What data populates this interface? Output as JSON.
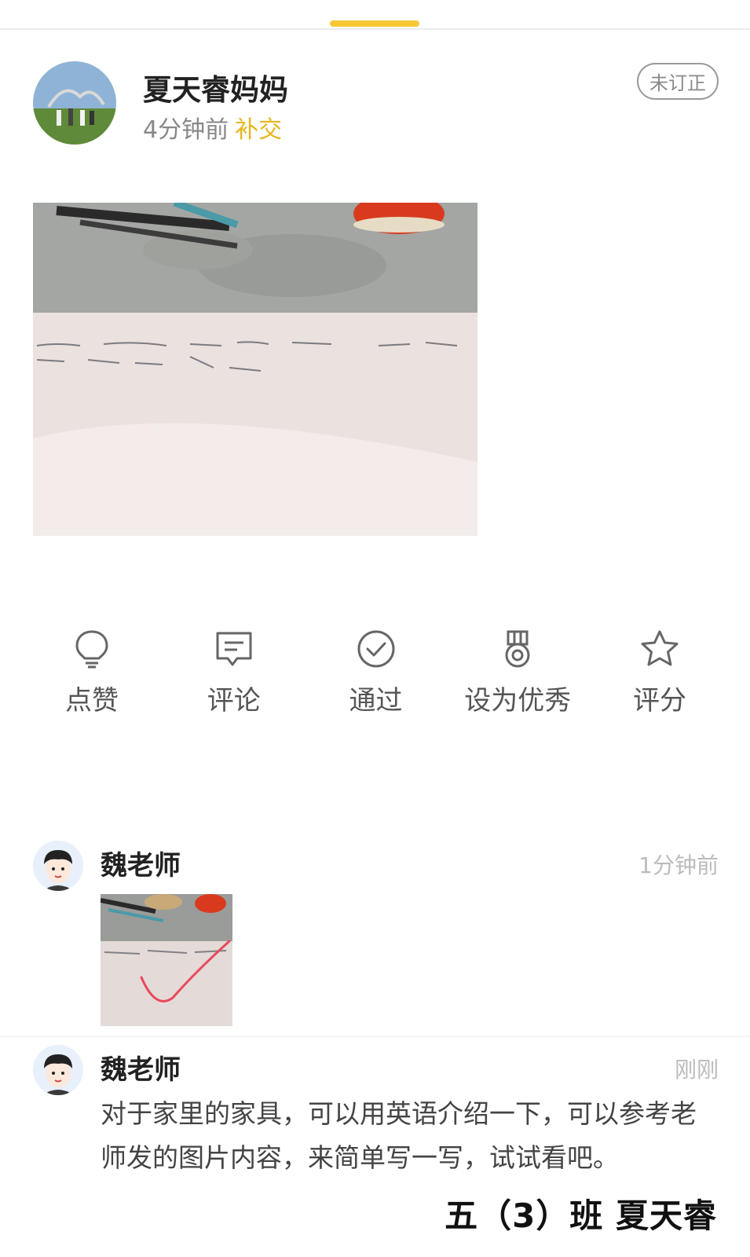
{
  "post": {
    "author": "夏天睿妈妈",
    "time": "4分钟前",
    "late_tag": "补交",
    "status_badge": "未订正",
    "accent_color": "#f6c836"
  },
  "actions": [
    {
      "label": "点赞",
      "icon": "lightbulb-icon"
    },
    {
      "label": "评论",
      "icon": "comment-icon"
    },
    {
      "label": "通过",
      "icon": "check-circle-icon"
    },
    {
      "label": "设为优秀",
      "icon": "medal-icon"
    },
    {
      "label": "评分",
      "icon": "star-icon"
    }
  ],
  "comments": [
    {
      "name": "魏老师",
      "time": "1分钟前"
    },
    {
      "name": "魏老师",
      "time": "刚刚",
      "text": "对于家里的家具，可以用英语介绍一下，可以参考老师发的图片内容，来简单写一写，试试看吧。"
    }
  ],
  "caption": "五（3）班 夏天睿"
}
